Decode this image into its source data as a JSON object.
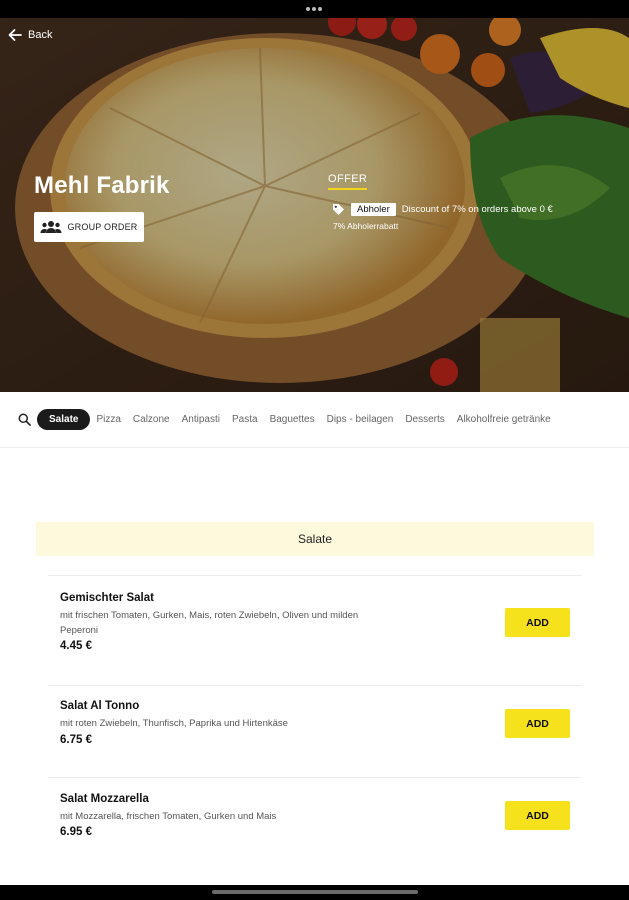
{
  "header": {
    "back_label": "Back",
    "store_name": "Mehl Fabrik",
    "group_order_label": "GROUP ORDER"
  },
  "offer": {
    "title": "OFFER",
    "badge": "Abholer",
    "text": "Discount of 7% on orders above 0 €",
    "subtext": "7% Abholerrabatt"
  },
  "categories": {
    "active": "Salate",
    "items": [
      "Pizza",
      "Calzone",
      "Antipasti",
      "Pasta",
      "Baguettes",
      "Dips - beilagen",
      "Desserts",
      "Alkoholfreie getränke"
    ]
  },
  "section": {
    "title": "Salate"
  },
  "menu_items": [
    {
      "name": "Gemischter Salat",
      "description": "mit frischen Tomaten, Gurken, Mais, roten Zwiebeln, Oliven und milden Peperoni",
      "price": "4.45 €",
      "add_label": "ADD"
    },
    {
      "name": "Salat Al Tonno",
      "description": "mit roten Zwiebeln, Thunfisch, Paprika und Hirtenkäse",
      "price": "6.75 €",
      "add_label": "ADD"
    },
    {
      "name": "Salat Mozzarella",
      "description": "mit Mozzarella, frischen Tomaten, Gurken und Mais",
      "price": "6.95 €",
      "add_label": "ADD"
    }
  ],
  "colors": {
    "accent": "#f6e21c",
    "section_bg": "#fdf9dc",
    "active_chip": "#1b1b1b"
  },
  "icons": [
    "back-arrow-icon",
    "group-icon",
    "tag-icon",
    "search-icon"
  ]
}
